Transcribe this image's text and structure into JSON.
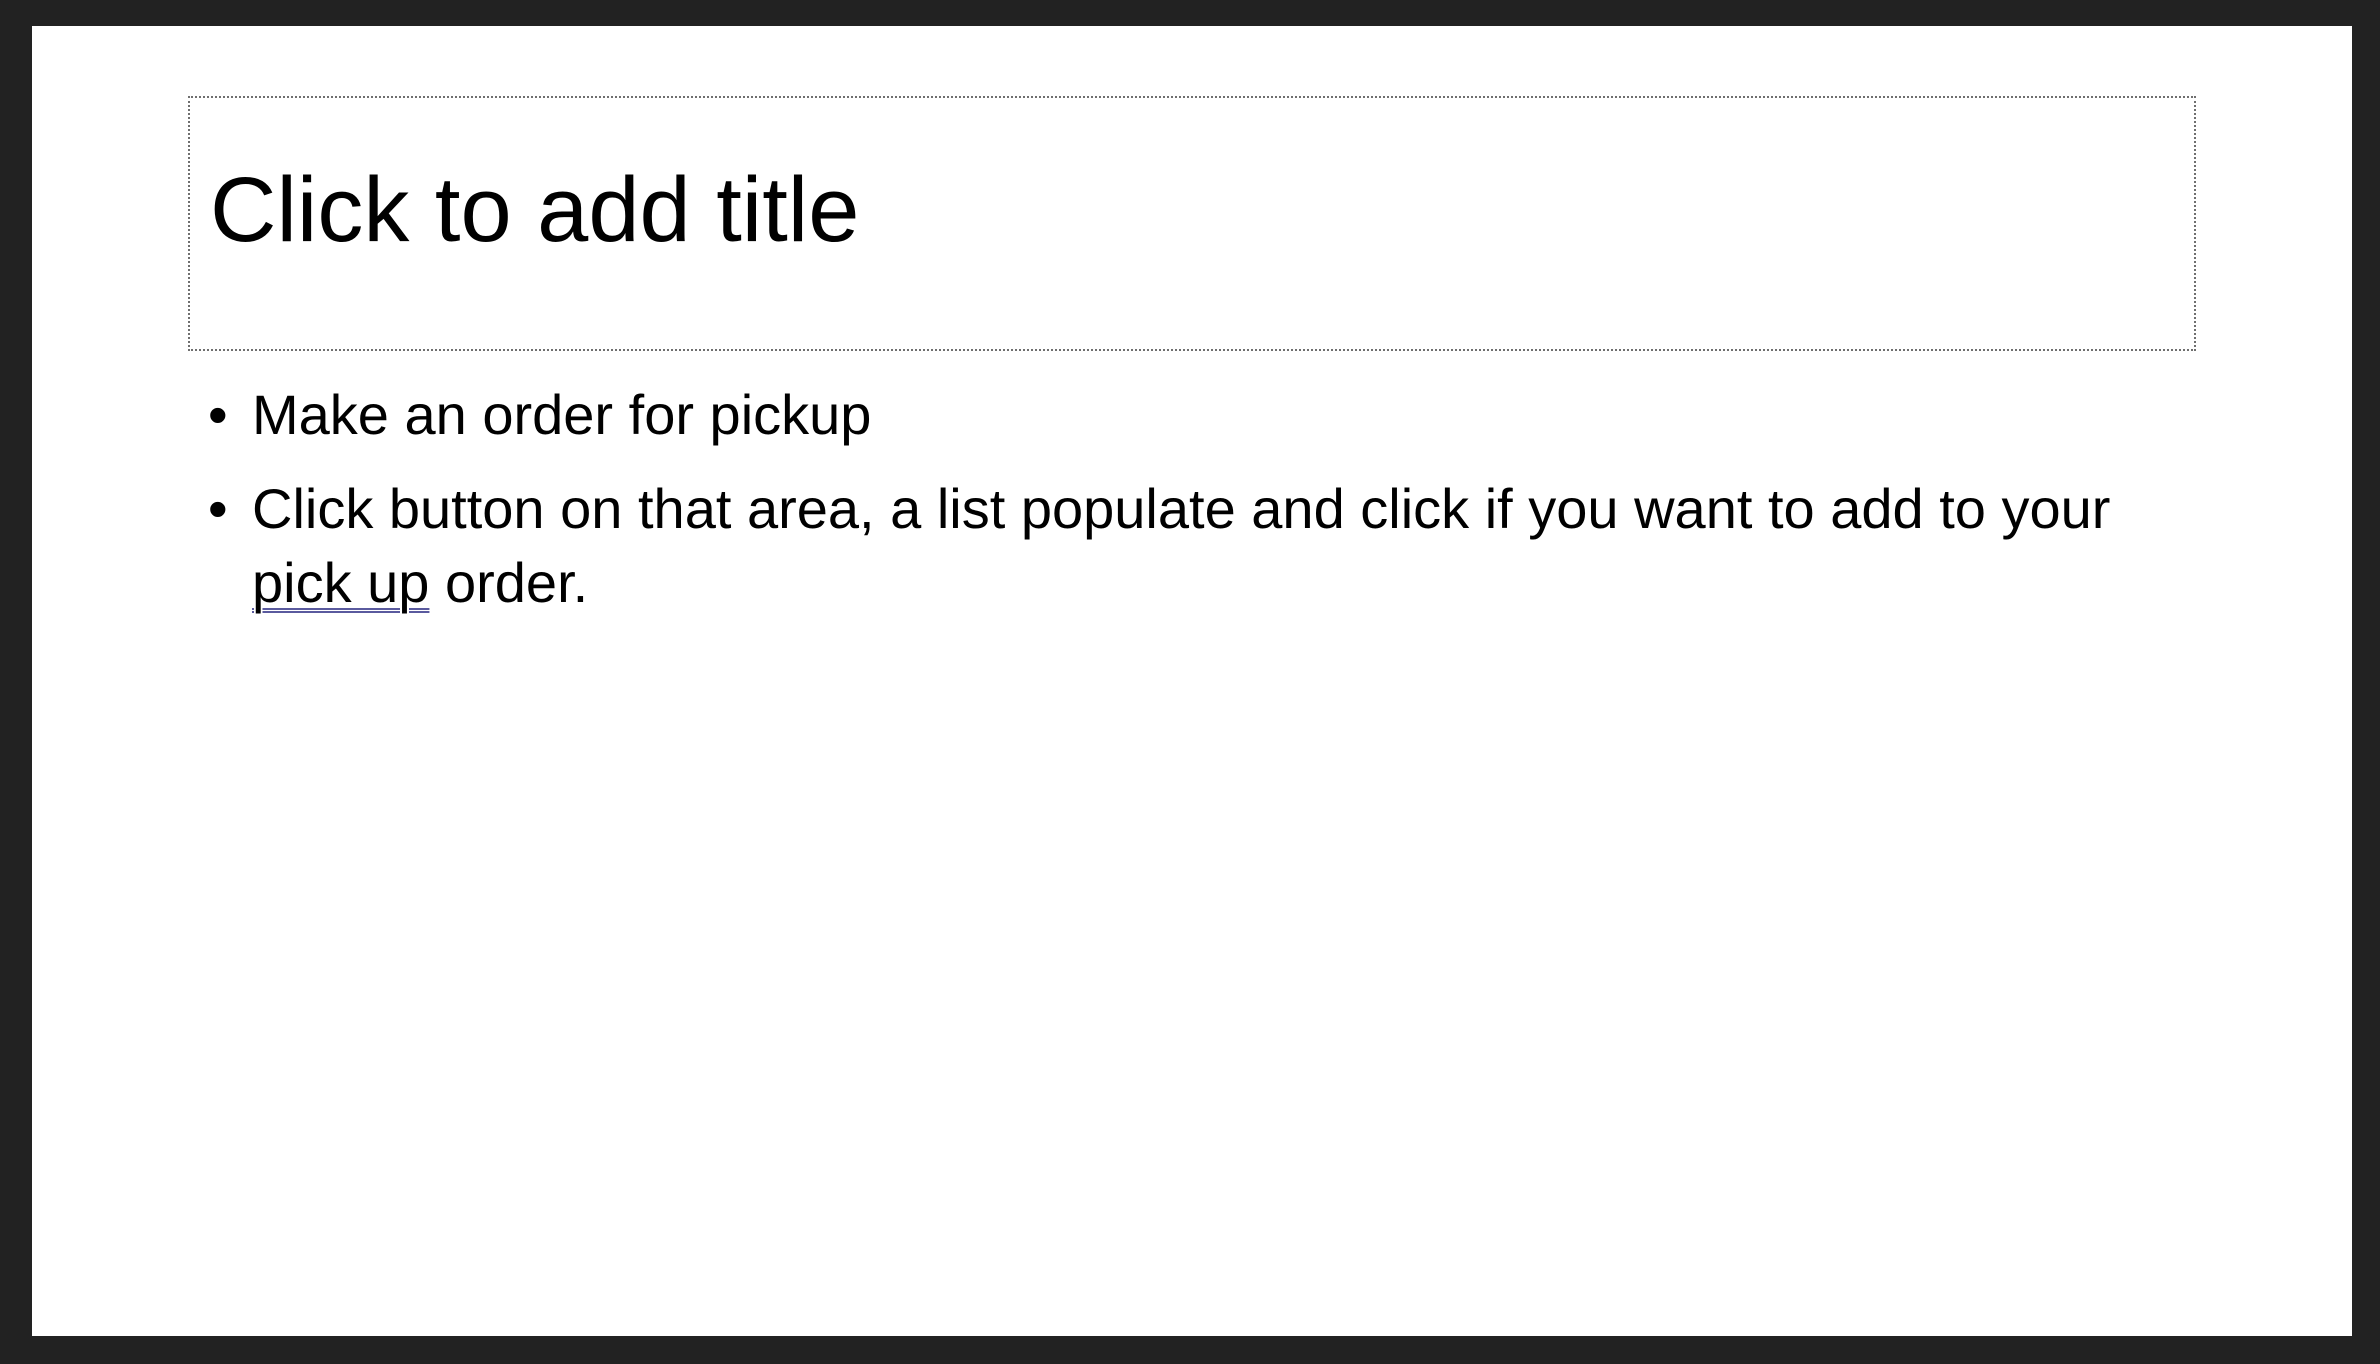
{
  "slide": {
    "title_placeholder": "Click to add title",
    "bullets": [
      {
        "marker": "•",
        "text": "Make an order for pickup"
      },
      {
        "marker": "•",
        "text_before": "Click button on that area, a list populate and click if you want to add to your ",
        "underlined": "pick up",
        "text_after": " order."
      }
    ]
  },
  "colors": {
    "frame": "#222222",
    "slide_background": "#ffffff",
    "placeholder_border": "#6f6f6f",
    "proofing_underline": "#5a5a9e"
  }
}
